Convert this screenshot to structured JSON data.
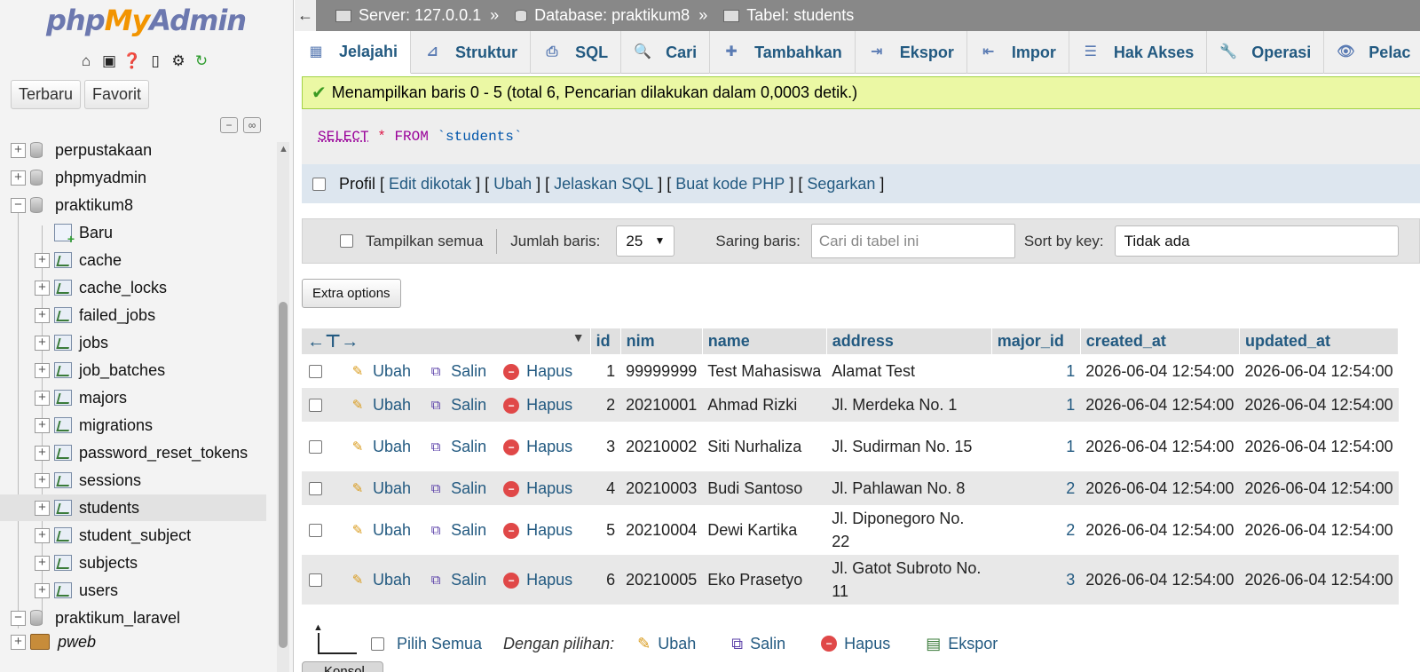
{
  "logo": {
    "php": "php",
    "my": "My",
    "admin": "Admin"
  },
  "nav_tabs": [
    "Terbaru",
    "Favorit"
  ],
  "tree": {
    "databases_top": [
      "perpustakaan",
      "phpmyadmin",
      "praktikum8"
    ],
    "new_label": "Baru",
    "tables": [
      "cache",
      "cache_locks",
      "failed_jobs",
      "jobs",
      "job_batches",
      "majors",
      "migrations",
      "password_reset_tokens",
      "sessions",
      "students",
      "student_subject",
      "subjects",
      "users"
    ],
    "active_table": "students",
    "databases_bottom": [
      "praktikum_laravel",
      "pweb"
    ]
  },
  "breadcrumb": {
    "server": "Server: 127.0.0.1",
    "database": "Database: praktikum8",
    "table": "Tabel: students",
    "separator": "»"
  },
  "tabs": [
    {
      "label": "Jelajahi",
      "icon": "browse-icon"
    },
    {
      "label": "Struktur",
      "icon": "structure-icon"
    },
    {
      "label": "SQL",
      "icon": "sql-icon"
    },
    {
      "label": "Cari",
      "icon": "search-icon"
    },
    {
      "label": "Tambahkan",
      "icon": "insert-icon"
    },
    {
      "label": "Ekspor",
      "icon": "export-icon"
    },
    {
      "label": "Impor",
      "icon": "import-icon"
    },
    {
      "label": "Hak Akses",
      "icon": "privileges-icon"
    },
    {
      "label": "Operasi",
      "icon": "operations-icon"
    },
    {
      "label": "Pelac",
      "icon": "tracking-icon"
    }
  ],
  "success_message": "Menampilkan baris 0 - 5 (total 6, Pencarian dilakukan dalam 0,0003 detik.)",
  "sql": {
    "select": "SELECT",
    "star": "*",
    "from": "FROM",
    "table": "`students`"
  },
  "profile": {
    "label": "Profil",
    "links": [
      "Edit dikotak",
      "Ubah",
      "Jelaskan SQL",
      "Buat kode PHP",
      "Segarkan"
    ]
  },
  "navbar": {
    "show_all": "Tampilkan semua",
    "rows_label": "Jumlah baris:",
    "rows_value": "25",
    "filter_label": "Saring baris:",
    "filter_placeholder": "Cari di tabel ini",
    "sort_label": "Sort by key:",
    "sort_value": "Tidak ada"
  },
  "extra_options": "Extra options",
  "columns": [
    "id",
    "nim",
    "name",
    "address",
    "major_id",
    "created_at",
    "updated_at"
  ],
  "row_actions": {
    "edit": "Ubah",
    "copy": "Salin",
    "delete": "Hapus"
  },
  "rows": [
    {
      "id": "1",
      "nim": "99999999",
      "name": "Test Mahasiswa",
      "address": "Alamat Test",
      "major_id": "1",
      "created_at": "2026-06-04 12:54:00",
      "updated_at": "2026-06-04 12:54:00"
    },
    {
      "id": "2",
      "nim": "20210001",
      "name": "Ahmad Rizki",
      "address": "Jl. Merdeka No. 1",
      "major_id": "1",
      "created_at": "2026-06-04 12:54:00",
      "updated_at": "2026-06-04 12:54:00"
    },
    {
      "id": "3",
      "nim": "20210002",
      "name": "Siti Nurhaliza",
      "address": "Jl. Sudirman No. 15",
      "major_id": "1",
      "created_at": "2026-06-04 12:54:00",
      "updated_at": "2026-06-04 12:54:00"
    },
    {
      "id": "4",
      "nim": "20210003",
      "name": "Budi Santoso",
      "address": "Jl. Pahlawan No. 8",
      "major_id": "2",
      "created_at": "2026-06-04 12:54:00",
      "updated_at": "2026-06-04 12:54:00"
    },
    {
      "id": "5",
      "nim": "20210004",
      "name": "Dewi Kartika",
      "address": "Jl. Diponegoro No. 22",
      "major_id": "2",
      "created_at": "2026-06-04 12:54:00",
      "updated_at": "2026-06-04 12:54:00"
    },
    {
      "id": "6",
      "nim": "20210005",
      "name": "Eko Prasetyo",
      "address": "Jl. Gatot Subroto No. 11",
      "major_id": "3",
      "created_at": "2026-06-04 12:54:00",
      "updated_at": "2026-06-04 12:54:00"
    }
  ],
  "bottom": {
    "select_all": "Pilih Semua",
    "with_selected": "Dengan pilihan:",
    "edit": "Ubah",
    "copy": "Salin",
    "delete": "Hapus",
    "export": "Ekspor"
  },
  "console_label": "Konsol"
}
